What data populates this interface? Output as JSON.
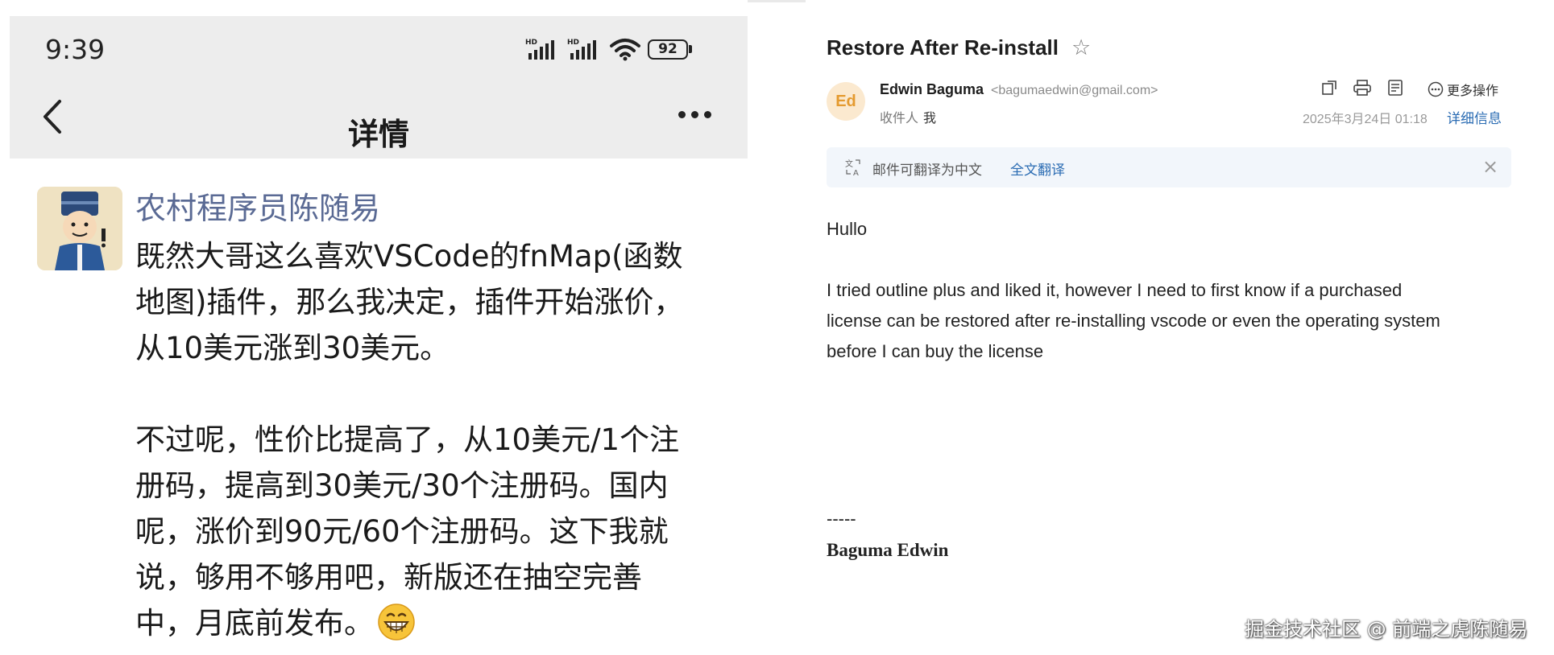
{
  "phone": {
    "status_time": "9:39",
    "battery_level": "92",
    "nav_title": "详情",
    "icons": [
      "back-icon",
      "more-icon",
      "signal-icon",
      "wifi-icon",
      "battery-icon"
    ]
  },
  "post": {
    "author": "农村程序员陈随易",
    "paragraph1": "既然大哥这么喜欢VSCode的fnMap(函数\n地图)插件，那么我决定，插件开始涨价，\n从10美元涨到30美元。",
    "paragraph2": "不过呢，性价比提高了，从10美元/1个注\n册码，提高到30美元/30个注册码。国内\n呢，涨价到90元/60个注册码。这下我就\n说，够用不够用吧，新版还在抽空完善\n中，月底前发布。"
  },
  "email": {
    "subject": "Restore After Re-install",
    "sender_initials": "Ed",
    "sender_name": "Edwin Baguma",
    "sender_email": "<bagumaedwin@gmail.com>",
    "recipient_label": "收件人",
    "recipient": "我",
    "more_actions": "更多操作",
    "date": "2025年3月24日 01:18",
    "details_link": "详细信息",
    "translate_text": "邮件可翻译为中文",
    "translate_link": "全文翻译",
    "greeting": "Hullo",
    "body_line1": "I tried outline plus and liked it, however I need to first know if a purchased",
    "body_line2": "license can be restored after re-installing vscode or even the operating system",
    "body_line3": "before I can buy the license",
    "signature_dash": "-----",
    "signature_name": "Baguma Edwin"
  },
  "watermark": "掘金技术社区 @ 前端之虎陈随易"
}
